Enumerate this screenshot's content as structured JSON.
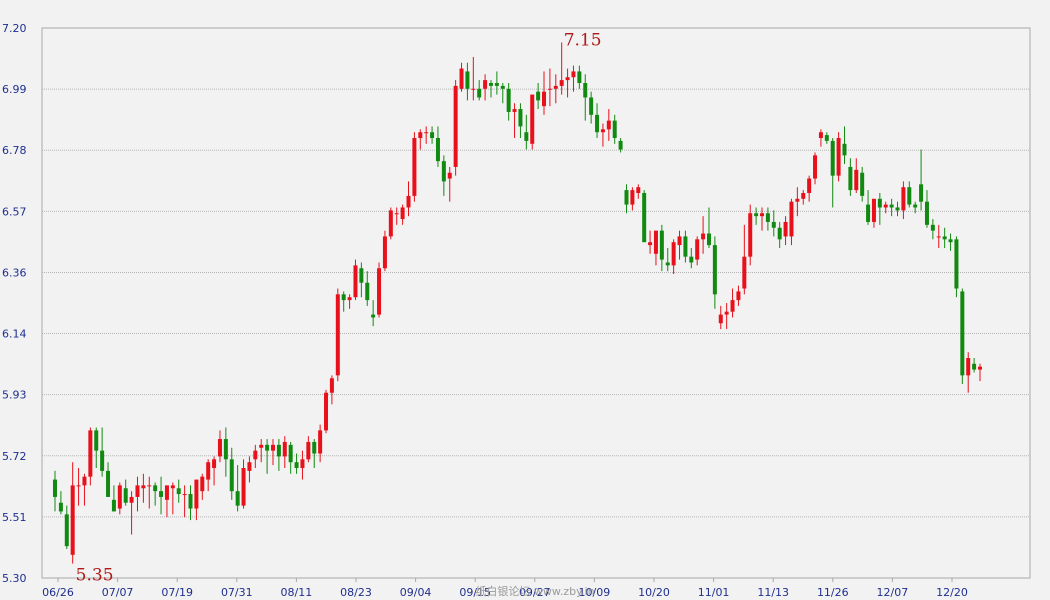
{
  "chart_data": {
    "type": "candlestick",
    "title": "",
    "xlabel": "",
    "ylabel": "",
    "ylim": [
      5.3,
      7.2
    ],
    "y_ticks": [
      "7.20",
      "6.99",
      "6.78",
      "6.57",
      "6.36",
      "6.14",
      "5.93",
      "5.72",
      "5.51",
      "5.30"
    ],
    "x_ticks": [
      "06/26",
      "07/07",
      "07/19",
      "07/31",
      "08/11",
      "08/23",
      "09/04",
      "09/15",
      "09/27",
      "10/09",
      "10/20",
      "11/01",
      "11/13",
      "11/26",
      "12/07",
      "12/20"
    ],
    "grid": true,
    "legend": "none",
    "colors": {
      "up": "#e8101a",
      "down": "#118a11",
      "grid": "#b4b4b4",
      "axis": "#1f2f8f",
      "annotation": "#b01818",
      "background": "#f2f2f2"
    },
    "annotations": [
      {
        "text": "7.15",
        "value": 7.15,
        "kind": "high"
      },
      {
        "text": "5.35",
        "value": 5.35,
        "kind": "low"
      }
    ],
    "candles_ohlc": [
      [
        5.64,
        5.67,
        5.53,
        5.58
      ],
      [
        5.56,
        5.6,
        5.52,
        5.53
      ],
      [
        5.52,
        5.55,
        5.4,
        5.41
      ],
      [
        5.38,
        5.7,
        5.35,
        5.62
      ],
      [
        5.62,
        5.68,
        5.55,
        5.62
      ],
      [
        5.62,
        5.66,
        5.55,
        5.65
      ],
      [
        5.65,
        5.82,
        5.62,
        5.81
      ],
      [
        5.81,
        5.82,
        5.68,
        5.74
      ],
      [
        5.74,
        5.82,
        5.65,
        5.67
      ],
      [
        5.67,
        5.7,
        5.58,
        5.58
      ],
      [
        5.57,
        5.62,
        5.53,
        5.53
      ],
      [
        5.54,
        5.63,
        5.52,
        5.62
      ],
      [
        5.61,
        5.64,
        5.55,
        5.56
      ],
      [
        5.56,
        5.6,
        5.45,
        5.58
      ],
      [
        5.58,
        5.65,
        5.53,
        5.62
      ],
      [
        5.61,
        5.66,
        5.56,
        5.62
      ],
      [
        5.62,
        5.65,
        5.54,
        5.62
      ],
      [
        5.62,
        5.63,
        5.55,
        5.6
      ],
      [
        5.6,
        5.65,
        5.52,
        5.58
      ],
      [
        5.57,
        5.61,
        5.51,
        5.62
      ],
      [
        5.61,
        5.63,
        5.52,
        5.62
      ],
      [
        5.61,
        5.64,
        5.56,
        5.59
      ],
      [
        5.59,
        5.62,
        5.51,
        5.59
      ],
      [
        5.59,
        5.62,
        5.5,
        5.54
      ],
      [
        5.54,
        5.63,
        5.5,
        5.64
      ],
      [
        5.6,
        5.66,
        5.57,
        5.65
      ],
      [
        5.64,
        5.71,
        5.6,
        5.7
      ],
      [
        5.68,
        5.72,
        5.62,
        5.71
      ],
      [
        5.72,
        5.81,
        5.7,
        5.78
      ],
      [
        5.78,
        5.82,
        5.65,
        5.71
      ],
      [
        5.71,
        5.75,
        5.57,
        5.6
      ],
      [
        5.6,
        5.69,
        5.53,
        5.55
      ],
      [
        5.55,
        5.71,
        5.54,
        5.68
      ],
      [
        5.67,
        5.72,
        5.63,
        5.7
      ],
      [
        5.71,
        5.76,
        5.68,
        5.74
      ],
      [
        5.75,
        5.78,
        5.7,
        5.76
      ],
      [
        5.76,
        5.78,
        5.66,
        5.74
      ],
      [
        5.74,
        5.78,
        5.69,
        5.76
      ],
      [
        5.76,
        5.78,
        5.67,
        5.72
      ],
      [
        5.72,
        5.79,
        5.68,
        5.77
      ],
      [
        5.76,
        5.77,
        5.66,
        5.7
      ],
      [
        5.7,
        5.73,
        5.66,
        5.68
      ],
      [
        5.68,
        5.74,
        5.64,
        5.71
      ],
      [
        5.71,
        5.79,
        5.7,
        5.77
      ],
      [
        5.77,
        5.78,
        5.68,
        5.73
      ],
      [
        5.73,
        5.83,
        5.7,
        5.81
      ],
      [
        5.81,
        5.95,
        5.8,
        5.94
      ],
      [
        5.94,
        6.0,
        5.9,
        5.99
      ],
      [
        6.0,
        6.3,
        5.98,
        6.28
      ],
      [
        6.28,
        6.29,
        6.22,
        6.26
      ],
      [
        6.26,
        6.28,
        6.23,
        6.27
      ],
      [
        6.27,
        6.4,
        6.26,
        6.38
      ],
      [
        6.37,
        6.39,
        6.27,
        6.32
      ],
      [
        6.32,
        6.36,
        6.24,
        6.26
      ],
      [
        6.21,
        6.26,
        6.17,
        6.2
      ],
      [
        6.21,
        6.39,
        6.2,
        6.37
      ],
      [
        6.37,
        6.5,
        6.36,
        6.48
      ],
      [
        6.48,
        6.58,
        6.47,
        6.57
      ],
      [
        6.56,
        6.58,
        6.52,
        6.56
      ],
      [
        6.54,
        6.59,
        6.52,
        6.58
      ],
      [
        6.58,
        6.67,
        6.55,
        6.62
      ],
      [
        6.62,
        6.84,
        6.6,
        6.82
      ],
      [
        6.82,
        6.85,
        6.78,
        6.84
      ],
      [
        6.84,
        6.86,
        6.8,
        6.84
      ],
      [
        6.84,
        6.86,
        6.8,
        6.82
      ],
      [
        6.82,
        6.86,
        6.72,
        6.74
      ],
      [
        6.74,
        6.76,
        6.62,
        6.67
      ],
      [
        6.68,
        6.72,
        6.6,
        6.7
      ],
      [
        6.72,
        7.02,
        6.69,
        7.0
      ],
      [
        6.99,
        7.08,
        6.98,
        7.06
      ],
      [
        7.05,
        7.08,
        6.95,
        6.99
      ],
      [
        6.99,
        7.1,
        6.95,
        6.99
      ],
      [
        6.99,
        7.02,
        6.95,
        6.96
      ],
      [
        6.99,
        7.04,
        6.95,
        7.02
      ],
      [
        7.01,
        7.02,
        6.96,
        7.0
      ],
      [
        7.01,
        7.05,
        6.97,
        7.0
      ],
      [
        7.0,
        7.01,
        6.94,
        6.99
      ],
      [
        6.99,
        7.01,
        6.88,
        6.91
      ],
      [
        6.91,
        6.94,
        6.82,
        6.92
      ],
      [
        6.92,
        6.94,
        6.82,
        6.86
      ],
      [
        6.84,
        6.9,
        6.78,
        6.81
      ],
      [
        6.8,
        6.97,
        6.78,
        6.97
      ],
      [
        6.98,
        7.01,
        6.92,
        6.95
      ],
      [
        6.93,
        7.05,
        6.9,
        6.98
      ],
      [
        6.99,
        7.06,
        6.93,
        6.99
      ],
      [
        6.99,
        7.04,
        6.94,
        7.0
      ],
      [
        7.0,
        7.15,
        6.97,
        7.02
      ],
      [
        7.02,
        7.06,
        6.96,
        7.03
      ],
      [
        7.03,
        7.07,
        6.98,
        7.05
      ],
      [
        7.05,
        7.07,
        6.99,
        7.01
      ],
      [
        7.01,
        7.04,
        6.88,
        6.96
      ],
      [
        6.96,
        6.98,
        6.87,
        6.9
      ],
      [
        6.9,
        6.94,
        6.82,
        6.84
      ],
      [
        6.84,
        6.87,
        6.79,
        6.85
      ],
      [
        6.85,
        6.92,
        6.81,
        6.88
      ],
      [
        6.88,
        6.9,
        6.8,
        6.82
      ],
      [
        6.81,
        6.82,
        6.77,
        6.78
      ],
      [
        6.64,
        6.66,
        6.56,
        6.59
      ],
      [
        6.59,
        6.65,
        6.57,
        6.64
      ],
      [
        6.63,
        6.66,
        6.61,
        6.65
      ],
      [
        6.63,
        6.64,
        6.49,
        6.46
      ],
      [
        6.45,
        6.5,
        6.42,
        6.46
      ],
      [
        6.42,
        6.48,
        6.38,
        6.5
      ],
      [
        6.5,
        6.52,
        6.36,
        6.4
      ],
      [
        6.39,
        6.44,
        6.36,
        6.38
      ],
      [
        6.38,
        6.47,
        6.35,
        6.46
      ],
      [
        6.45,
        6.5,
        6.4,
        6.48
      ],
      [
        6.48,
        6.5,
        6.39,
        6.41
      ],
      [
        6.41,
        6.44,
        6.37,
        6.39
      ],
      [
        6.4,
        6.48,
        6.38,
        6.47
      ],
      [
        6.47,
        6.55,
        6.42,
        6.49
      ],
      [
        6.49,
        6.58,
        6.44,
        6.45
      ],
      [
        6.45,
        6.48,
        6.23,
        6.28
      ],
      [
        6.18,
        6.24,
        6.16,
        6.21
      ],
      [
        6.21,
        6.25,
        6.16,
        6.22
      ],
      [
        6.22,
        6.3,
        6.2,
        6.26
      ],
      [
        6.26,
        6.31,
        6.24,
        6.29
      ],
      [
        6.3,
        6.52,
        6.28,
        6.41
      ],
      [
        6.41,
        6.59,
        6.38,
        6.56
      ],
      [
        6.56,
        6.58,
        6.52,
        6.55
      ],
      [
        6.55,
        6.58,
        6.5,
        6.56
      ],
      [
        6.56,
        6.58,
        6.5,
        6.53
      ],
      [
        6.53,
        6.57,
        6.48,
        6.51
      ],
      [
        6.51,
        6.53,
        6.44,
        6.47
      ],
      [
        6.48,
        6.55,
        6.45,
        6.53
      ],
      [
        6.48,
        6.61,
        6.45,
        6.6
      ],
      [
        6.6,
        6.65,
        6.55,
        6.61
      ],
      [
        6.61,
        6.64,
        6.59,
        6.63
      ],
      [
        6.63,
        6.69,
        6.6,
        6.68
      ],
      [
        6.68,
        6.77,
        6.66,
        6.76
      ],
      [
        6.82,
        6.85,
        6.79,
        6.84
      ],
      [
        6.83,
        6.84,
        6.8,
        6.81
      ],
      [
        6.81,
        6.82,
        6.58,
        6.69
      ],
      [
        6.69,
        6.84,
        6.67,
        6.82
      ],
      [
        6.8,
        6.86,
        6.73,
        6.76
      ],
      [
        6.72,
        6.75,
        6.62,
        6.64
      ],
      [
        6.64,
        6.75,
        6.63,
        6.71
      ],
      [
        6.7,
        6.72,
        6.6,
        6.62
      ],
      [
        6.59,
        6.64,
        6.52,
        6.53
      ],
      [
        6.53,
        6.6,
        6.51,
        6.61
      ],
      [
        6.61,
        6.63,
        6.52,
        6.58
      ],
      [
        6.58,
        6.6,
        6.56,
        6.59
      ],
      [
        6.59,
        6.61,
        6.55,
        6.58
      ],
      [
        6.58,
        6.6,
        6.55,
        6.57
      ],
      [
        6.57,
        6.67,
        6.54,
        6.65
      ],
      [
        6.65,
        6.67,
        6.58,
        6.59
      ],
      [
        6.59,
        6.6,
        6.56,
        6.58
      ],
      [
        6.66,
        6.78,
        6.57,
        6.6
      ],
      [
        6.6,
        6.64,
        6.51,
        6.52
      ],
      [
        6.52,
        6.54,
        6.47,
        6.5
      ],
      [
        6.48,
        6.52,
        6.44,
        6.48
      ],
      [
        6.48,
        6.51,
        6.44,
        6.47
      ],
      [
        6.47,
        6.49,
        6.43,
        6.46
      ],
      [
        6.47,
        6.48,
        6.27,
        6.3
      ],
      [
        6.29,
        6.3,
        5.97,
        6.0
      ],
      [
        6.0,
        6.08,
        5.94,
        6.06
      ],
      [
        6.04,
        6.06,
        6.01,
        6.02
      ],
      [
        6.02,
        6.04,
        5.98,
        6.03
      ]
    ]
  },
  "watermark": "纸白银论坛 www.zby.in"
}
